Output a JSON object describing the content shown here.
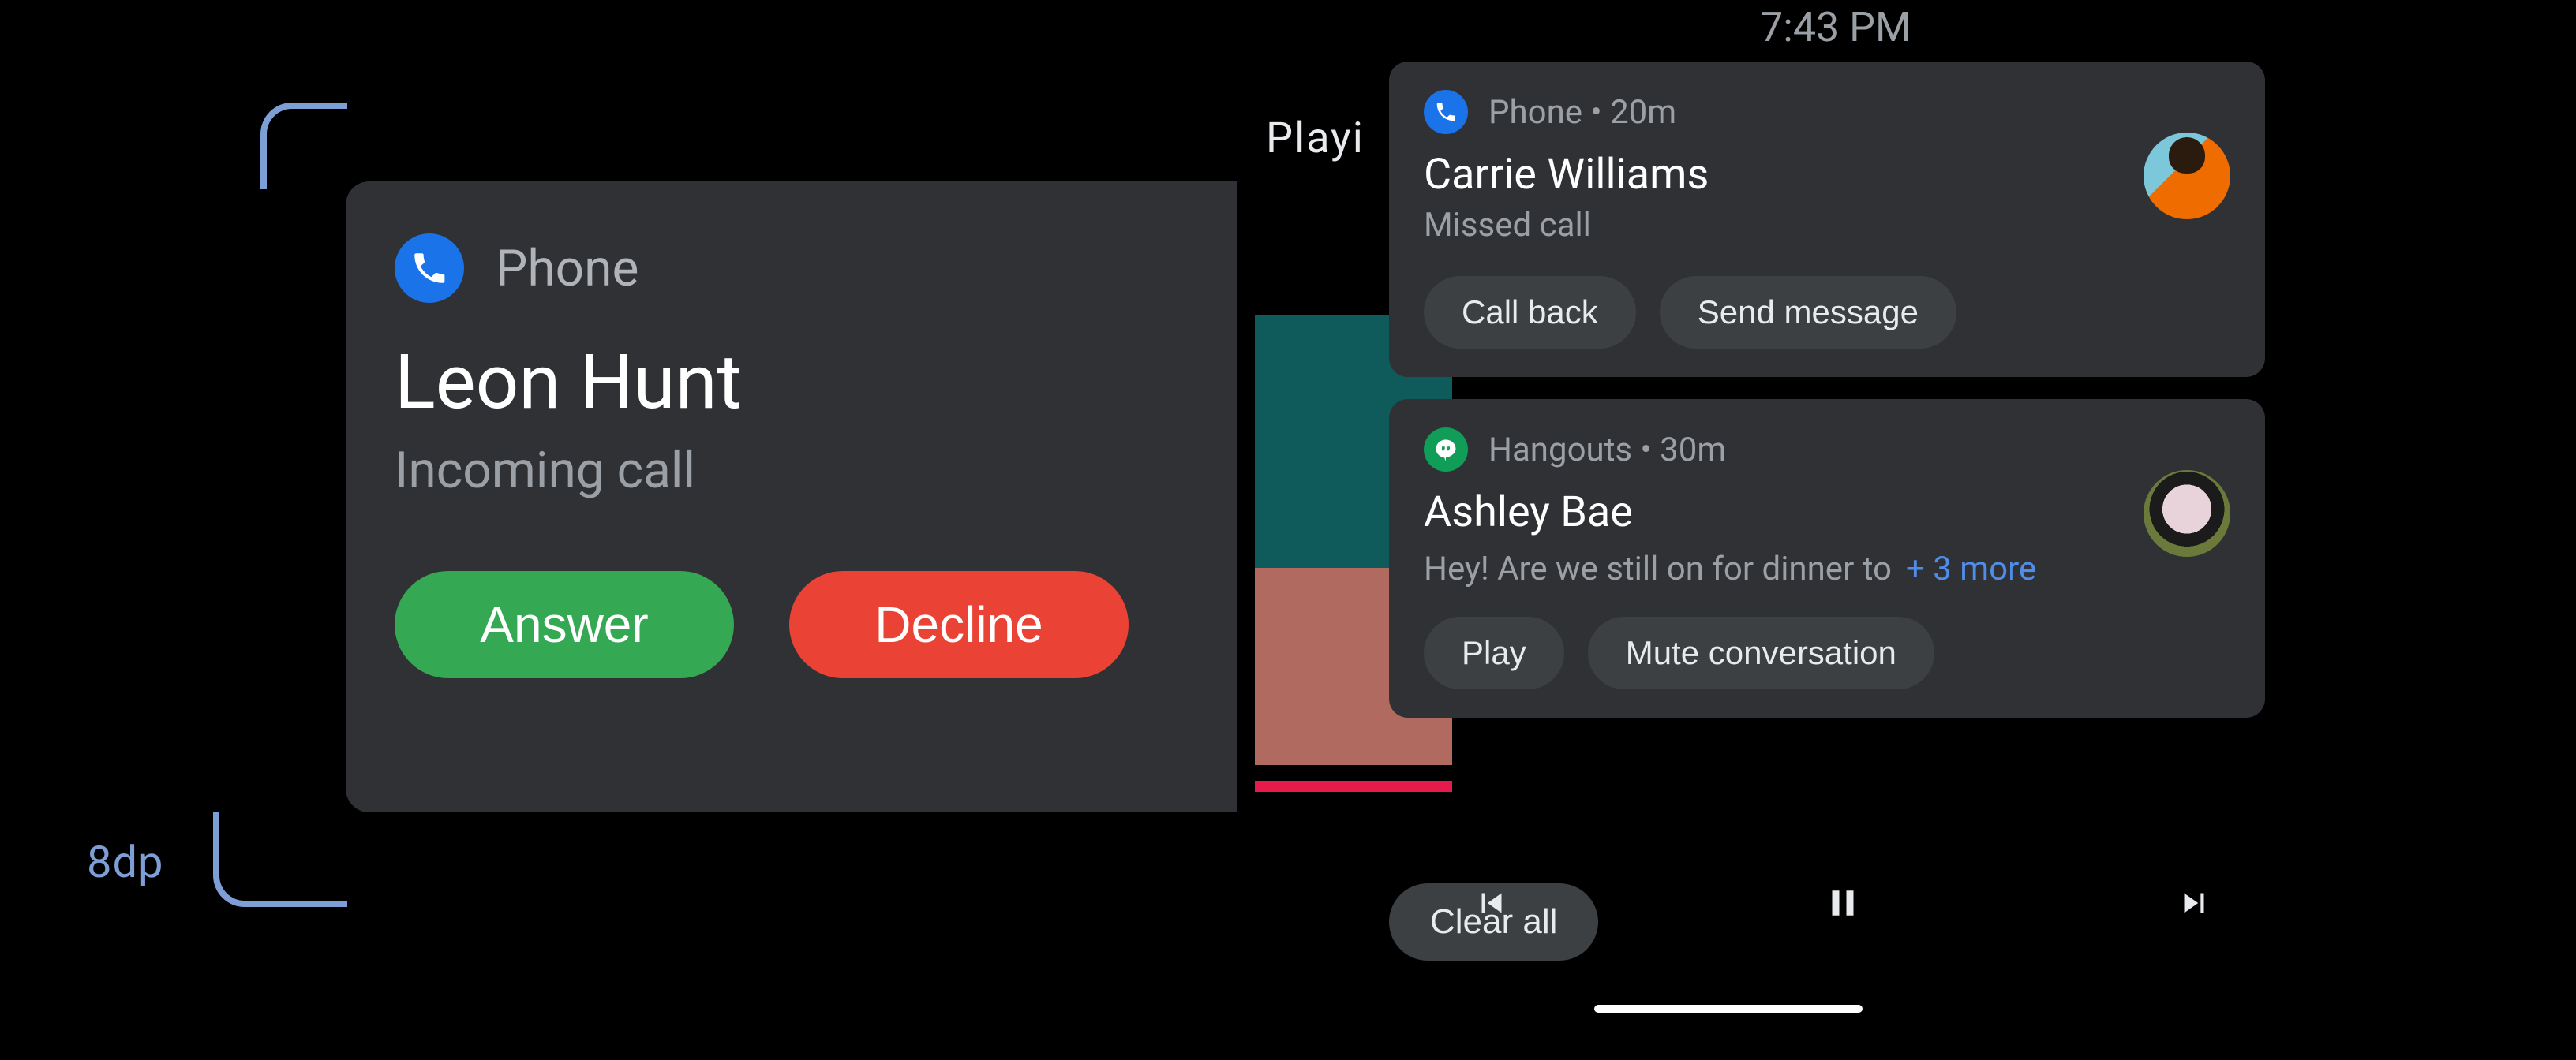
{
  "annotation": {
    "padding_label": "8dp"
  },
  "left_card": {
    "app_label": "Phone",
    "caller": "Leon Hunt",
    "status": "Incoming call",
    "answer_label": "Answer",
    "decline_label": "Decline",
    "icon": "phone-icon",
    "colors": {
      "answer": "#34a853",
      "decline": "#ea4335",
      "accent": "#1a73e8"
    }
  },
  "right": {
    "clock": "7:43 PM",
    "background_label": "Playi",
    "clear_all_label": "Clear all",
    "notifications": [
      {
        "app": "Phone",
        "app_icon": "phone-icon",
        "time": "20m",
        "title": "Carrie Williams",
        "subtitle": "Missed call",
        "more": "",
        "actions": [
          "Call back",
          "Send message"
        ],
        "avatar": "carrie"
      },
      {
        "app": "Hangouts",
        "app_icon": "hangouts-icon",
        "time": "30m",
        "title": "Ashley Bae",
        "subtitle": "Hey! Are we still on for dinner to",
        "more": "+ 3 more",
        "actions": [
          "Play",
          "Mute conversation"
        ],
        "avatar": "ashley"
      }
    ],
    "media": {
      "prev": "skip-previous-icon",
      "pause": "pause-icon",
      "next": "skip-next-icon"
    }
  }
}
